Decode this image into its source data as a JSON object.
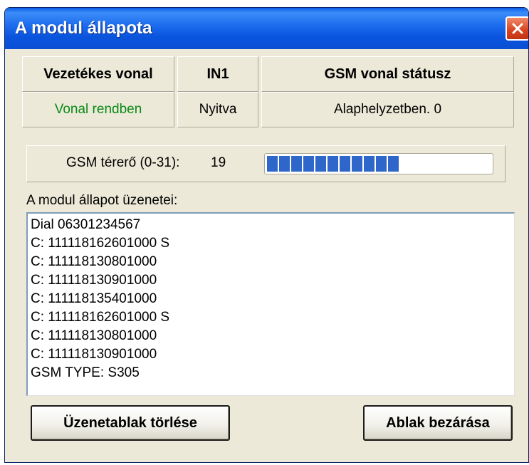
{
  "window": {
    "title": "A modul állapota"
  },
  "status": {
    "wired_header": "Vezetékes vonal",
    "wired_value": "Vonal rendben",
    "in_header": "IN1",
    "in_value": "Nyitva",
    "gsm_header": "GSM vonal státusz",
    "gsm_value": "Alaphelyzetben. 0"
  },
  "signal": {
    "label": "GSM térerő (0-31):",
    "value": "19",
    "level": 19,
    "max": 31
  },
  "messages": {
    "label": "A modul állapot üzenetei:",
    "lines": [
      "Dial 06301234567",
      "C: 111118162601000 S",
      "C: 111118130801000",
      "C: 111118130901000",
      "C: 111118135401000",
      "C: 111118162601000 S",
      "C: 111118130801000",
      "C: 111118130901000",
      "GSM TYPE: S305"
    ]
  },
  "buttons": {
    "clear": "Üzenetablak törlése",
    "close": "Ablak bezárása"
  },
  "colors": {
    "ok_text": "#0a8a16",
    "progress": "#2e66c9",
    "titlebar": "#0a55de"
  }
}
